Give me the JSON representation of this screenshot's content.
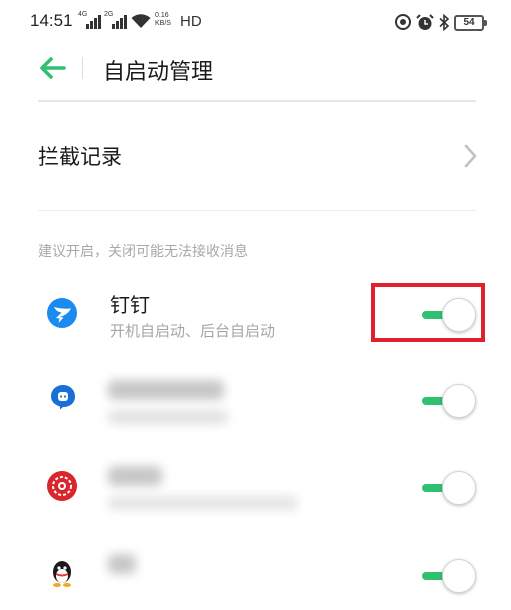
{
  "status_bar": {
    "time": "14:51",
    "sim1_tag": "4G",
    "sim2_tag": "2G",
    "speed_value": "0.16",
    "speed_unit": "KB/S",
    "hd_label": "HD",
    "battery_level": "54",
    "icons": [
      "signal-icon",
      "wifi-icon",
      "nfc-icon",
      "alarm-icon",
      "bluetooth-icon",
      "battery-icon"
    ]
  },
  "header": {
    "title": "自启动管理",
    "back_icon": "arrow-left-icon",
    "accent_color": "#2fc16f"
  },
  "intercept": {
    "label": "拦截记录",
    "chevron_icon": "chevron-right-icon"
  },
  "section_hint": "建议开启，关闭可能无法接收消息",
  "apps": [
    {
      "name": "钉钉",
      "desc": "开机自启动、后台自启动",
      "icon": "dingtalk-icon",
      "enabled": true,
      "highlighted": true
    },
    {
      "name": "",
      "desc": "",
      "icon": "chat-bubble-app-icon",
      "enabled": true,
      "blurred": true
    },
    {
      "name": "",
      "desc": "",
      "icon": "red-pattern-app-icon",
      "enabled": true,
      "blurred": true
    },
    {
      "name": "",
      "desc": "",
      "icon": "qq-penguin-icon",
      "enabled": true,
      "blurred": true
    }
  ],
  "colors": {
    "toggle_on": "#2fc16f",
    "highlight_border": "#e0202d",
    "hint_text": "#a8a8a8"
  }
}
